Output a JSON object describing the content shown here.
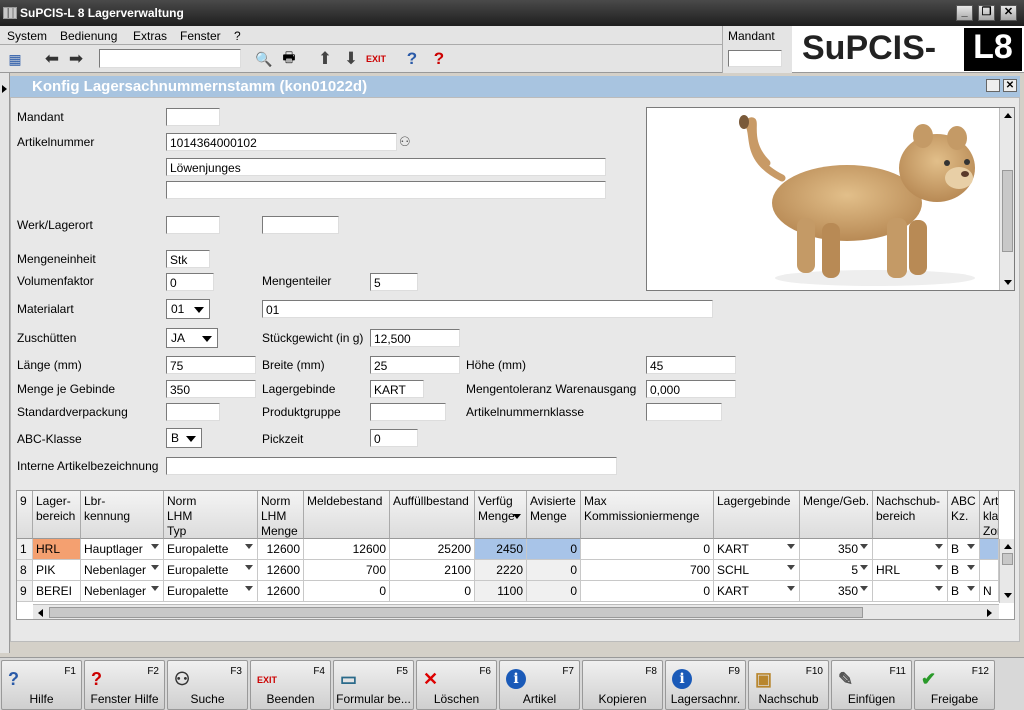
{
  "window": {
    "title": "SuPCIS-L 8 Lagerverwaltung"
  },
  "menu": [
    "System",
    "Bedienung",
    "Extras",
    "Fenster",
    "?"
  ],
  "mandant_label": "Mandant",
  "logo": {
    "left": "SuPCIS-",
    "right": "L8"
  },
  "panel": {
    "title": "Konfig Lagersachnummernstamm (kon01022d)"
  },
  "form": {
    "mandant_label": "Mandant",
    "mandant_value": "",
    "artikelnummer_label": "Artikelnummer",
    "artikelnummer_value": "1014364000102",
    "bezeichnung1": "Löwenjunges",
    "bezeichnung2": "",
    "werk_label": "Werk/Lagerort",
    "werk_value": "",
    "lagerort_value": "",
    "mengeneinheit_label": "Mengeneinheit",
    "mengeneinheit_value": "Stk",
    "volumenfaktor_label": "Volumenfaktor",
    "volumenfaktor_value": "0",
    "mengenteiler_label": "Mengenteiler",
    "mengenteiler_value": "5",
    "materialart_label": "Materialart",
    "materialart_value": "01",
    "materialart_text": "01",
    "zuschuetten_label": "Zuschütten",
    "zuschuetten_value": "JA",
    "stueckgewicht_label": "Stückgewicht (in g)",
    "stueckgewicht_value": "12,500",
    "laenge_label": "Länge (mm)",
    "laenge_value": "75",
    "breite_label": "Breite (mm)",
    "breite_value": "25",
    "hoehe_label": "Höhe (mm)",
    "hoehe_value": "45",
    "menge_gebinde_label": "Menge je Gebinde",
    "menge_gebinde_value": "350",
    "lagergebinde_label": "Lagergebinde",
    "lagergebinde_value": "KART",
    "mengentoleranz_label": "Mengentoleranz Warenausgang",
    "mengentoleranz_value": "0,000",
    "standardverpackung_label": "Standardverpackung",
    "standardverpackung_value": "",
    "produktgruppe_label": "Produktgruppe",
    "produktgruppe_value": "",
    "artikelnummernklasse_label": "Artikelnummernklasse",
    "artikelnummernklasse_value": "",
    "abc_label": "ABC-Klasse",
    "abc_value": "B",
    "pickzeit_label": "Pickzeit",
    "pickzeit_value": "0",
    "interne_label": "Interne Artikelbezeichnung",
    "interne_value": ""
  },
  "grid": {
    "headers": [
      "9",
      "Lager-\nbereich",
      "Lbr-\nkennung",
      "Norm\nLHM\nTyp",
      "Norm\nLHM\nMenge",
      "Meldebestand",
      "Auffüllbestand",
      "Verfüg\nMenge",
      "Avisierte\nMenge",
      "Max\nKommissioniermenge",
      "Lagergebinde",
      "Menge/Geb.",
      "Nachschub-\nbereich",
      "ABC\nKz.",
      "Arti\nkla\nZon"
    ],
    "rows": [
      [
        "1",
        "HRL",
        "Hauptlager",
        "Europalette",
        "12600",
        "12600",
        "25200",
        "2450",
        "0",
        "0",
        "KART",
        "350",
        "",
        "B",
        ""
      ],
      [
        "8",
        "PIK",
        "Nebenlager",
        "Europalette",
        "12600",
        "700",
        "2100",
        "2220",
        "0",
        "700",
        "SCHL",
        "5",
        "HRL",
        "B",
        ""
      ],
      [
        "9",
        "BEREI",
        "Nebenlager",
        "Europalette",
        "12600",
        "0",
        "0",
        "1100",
        "0",
        "0",
        "KART",
        "350",
        "",
        "B",
        "N"
      ]
    ]
  },
  "fkeys": [
    {
      "num": "F1",
      "label": "Hilfe",
      "icon": "help-icon"
    },
    {
      "num": "F2",
      "label": "Fenster Hilfe",
      "icon": "window-help-icon"
    },
    {
      "num": "F3",
      "label": "Suche",
      "icon": "binoculars-icon"
    },
    {
      "num": "F4",
      "label": "Beenden",
      "icon": "exit-icon"
    },
    {
      "num": "F5",
      "label": "Formular be...",
      "icon": "form-icon"
    },
    {
      "num": "F6",
      "label": "Löschen",
      "icon": "delete-icon"
    },
    {
      "num": "F7",
      "label": "Artikel",
      "icon": "info-icon"
    },
    {
      "num": "F8",
      "label": "Kopieren",
      "icon": ""
    },
    {
      "num": "F9",
      "label": "Lagersachnr.",
      "icon": "info-icon"
    },
    {
      "num": "F10",
      "label": "Nachschub",
      "icon": "box-icon"
    },
    {
      "num": "F11",
      "label": "Einfügen",
      "icon": "insert-icon"
    },
    {
      "num": "F12",
      "label": "Freigabe",
      "icon": "check-icon"
    }
  ],
  "colors": {
    "title_bar": "#2a2a2a",
    "panel_header": "#a8c4e0",
    "selected_cell": "#f4a070",
    "highlight_cell": "#a8c4e8"
  }
}
